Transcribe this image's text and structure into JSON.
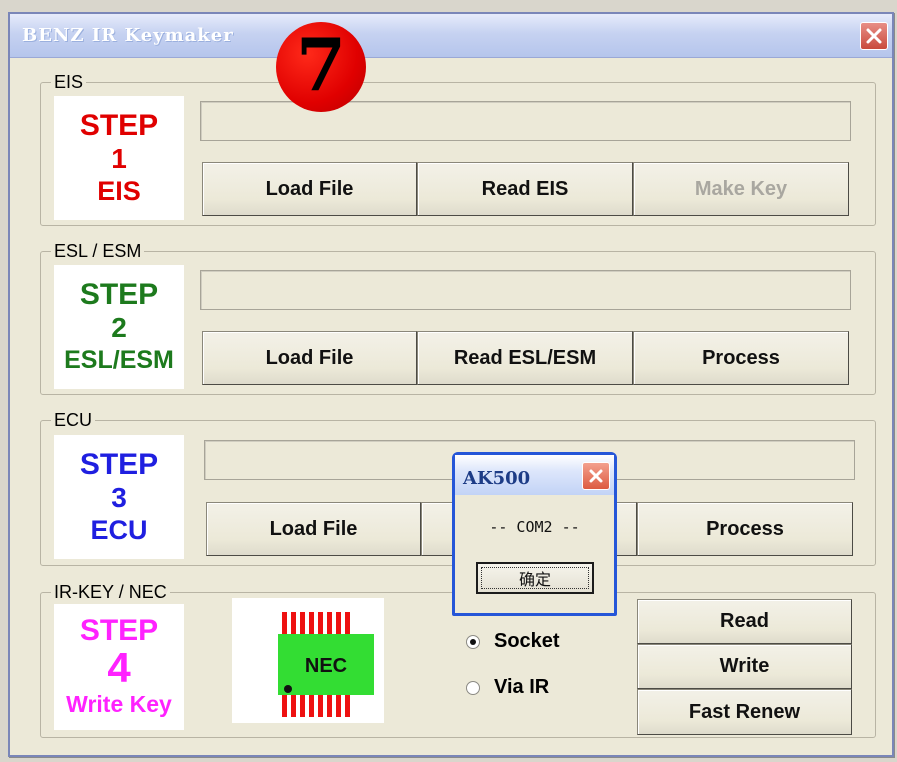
{
  "window": {
    "title": "BENZ IR Keymaker",
    "overlay_badge": "7"
  },
  "colors": {
    "step1": "#e00000",
    "step2": "#1d7a1d",
    "step3": "#1f1fe0",
    "step4": "#ff22ff",
    "chip_body": "#33dd33",
    "chip_pins": "#ee1111"
  },
  "groups": {
    "eis": {
      "label": "EIS",
      "step": [
        "STEP",
        "1",
        "EIS"
      ],
      "buttons": {
        "load": "Load File",
        "read": "Read EIS",
        "action": "Make Key"
      }
    },
    "esl": {
      "label": "ESL / ESM",
      "step": [
        "STEP",
        "2",
        "ESL/ESM"
      ],
      "buttons": {
        "load": "Load File",
        "read": "Read ESL/ESM",
        "action": "Process"
      }
    },
    "ecu": {
      "label": "ECU",
      "step": [
        "STEP",
        "3",
        "ECU"
      ],
      "buttons": {
        "load": "Load File",
        "action": "Process"
      }
    },
    "irkey": {
      "label": "IR-KEY / NEC",
      "step": [
        "STEP",
        "4",
        "Write Key"
      ],
      "chip_label": "NEC",
      "radios": [
        {
          "label": "Socket",
          "selected": true
        },
        {
          "label": "Via IR",
          "selected": false
        }
      ],
      "buttons": {
        "read": "Read",
        "write": "Write",
        "renew": "Fast Renew"
      }
    }
  },
  "dialog": {
    "title": "AK500",
    "message": "-- COM2 --",
    "ok_label": "确定"
  }
}
